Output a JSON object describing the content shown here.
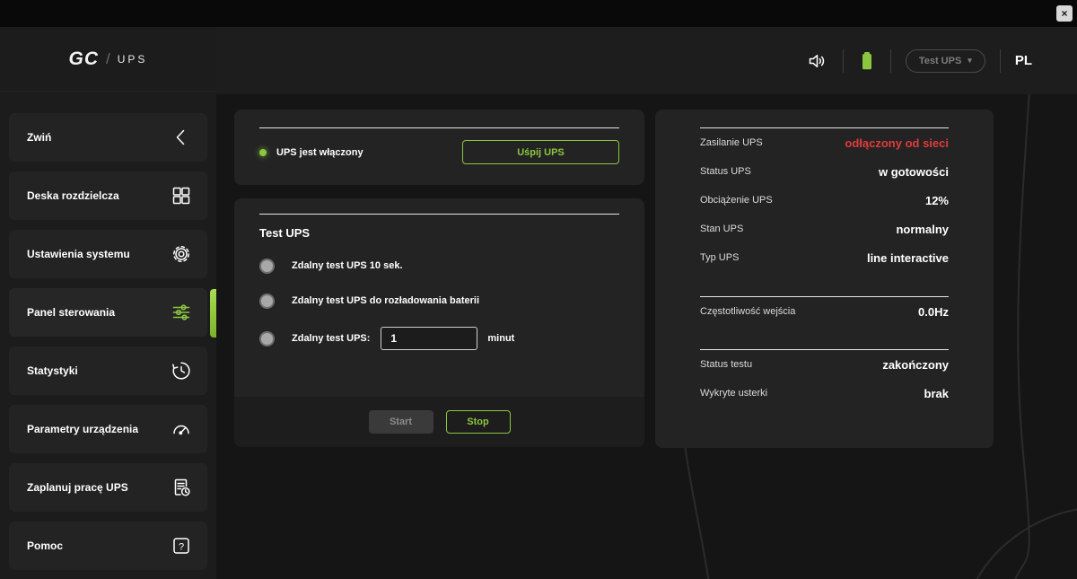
{
  "window": {
    "close_label": "×"
  },
  "sidebar": {
    "logo_gc": "GC",
    "logo_sep": "/",
    "logo_ups": "UPS",
    "items": [
      {
        "label": "Zwiń",
        "icon": "chevron-left-icon"
      },
      {
        "label": "Deska rozdzielcza",
        "icon": "dashboard-grid-icon"
      },
      {
        "label": "Ustawienia systemu",
        "icon": "gear-icon"
      },
      {
        "label": "Panel sterowania",
        "icon": "sliders-icon"
      },
      {
        "label": "Statystyki",
        "icon": "history-clock-icon"
      },
      {
        "label": "Parametry urządzenia",
        "icon": "gauge-icon"
      },
      {
        "label": "Zaplanuj pracę UPS",
        "icon": "schedule-document-icon"
      },
      {
        "label": "Pomoc",
        "icon": "help-icon"
      }
    ]
  },
  "header": {
    "device_selector_label": "Test UPS",
    "device_selector_caret": "▾",
    "language": "PL",
    "icons": [
      "speaker-icon",
      "battery-icon"
    ]
  },
  "power_card": {
    "status_label": "UPS jest włączony",
    "sleep_button_label": "Uśpij UPS"
  },
  "test_card": {
    "title": "Test UPS",
    "option_1": "Zdalny test UPS 10 sek.",
    "option_2": "Zdalny test UPS do rozładowania baterii",
    "option_3": "Zdalny test UPS:",
    "minutes_value": "1",
    "minutes_unit": "minut",
    "start_label": "Start",
    "stop_label": "Stop"
  },
  "info_card": {
    "rows": [
      {
        "label": "Zasilanie UPS",
        "value": "odłączony od sieci"
      },
      {
        "label": "Status UPS",
        "value": "w gotowości"
      },
      {
        "label": "Obciążenie UPS",
        "value": "12%"
      },
      {
        "label": "Stan UPS",
        "value": "normalny"
      },
      {
        "label": "Typ UPS",
        "value": "line interactive"
      },
      {
        "label": "Częstotliwość wejścia",
        "value": "0.0Hz"
      },
      {
        "label": "Status testu",
        "value": "zakończony"
      },
      {
        "label": "Wykryte usterki",
        "value": "brak"
      }
    ]
  },
  "colors": {
    "accent": "#8cc63f",
    "danger": "#e23b3b"
  }
}
